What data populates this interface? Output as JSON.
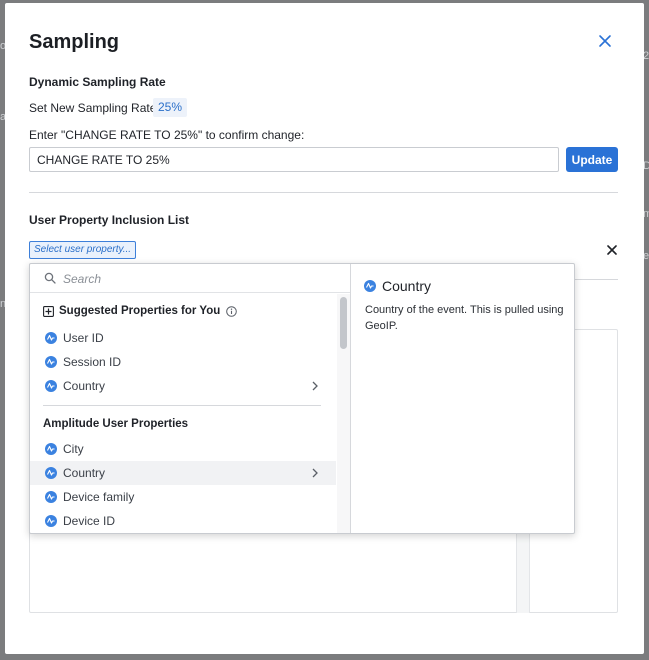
{
  "modal": {
    "title": "Sampling"
  },
  "dynamic_sampling": {
    "heading": "Dynamic Sampling Rate",
    "set_rate_label": "Set New Sampling Rate:",
    "rate_value": "25%",
    "confirm_prompt": "Enter \"CHANGE RATE TO 25%\" to confirm change:",
    "confirm_input_value": "CHANGE RATE TO 25%",
    "update_label": "Update"
  },
  "inclusion": {
    "heading": "User Property Inclusion List",
    "select_placeholder": "Select user property..."
  },
  "dropdown": {
    "search_placeholder": "Search",
    "suggested_heading": "Suggested Properties for You",
    "suggested_items": [
      {
        "label": "User ID"
      },
      {
        "label": "Session ID"
      },
      {
        "label": "Country"
      }
    ],
    "amplitude_heading": "Amplitude User Properties",
    "amplitude_items": [
      {
        "label": "City"
      },
      {
        "label": "Country"
      },
      {
        "label": "Device family"
      },
      {
        "label": "Device ID"
      }
    ],
    "detail": {
      "title": "Country",
      "description": "Country of the event. This is pulled using GeoIP."
    }
  },
  "background_fragments": [
    "ol",
    "at",
    "2",
    "D",
    "nl",
    "mb",
    "ep"
  ],
  "colors": {
    "accent": "#2a72d6",
    "icon_blue": "#3b82e0",
    "overlay": "#7b7c7e"
  }
}
